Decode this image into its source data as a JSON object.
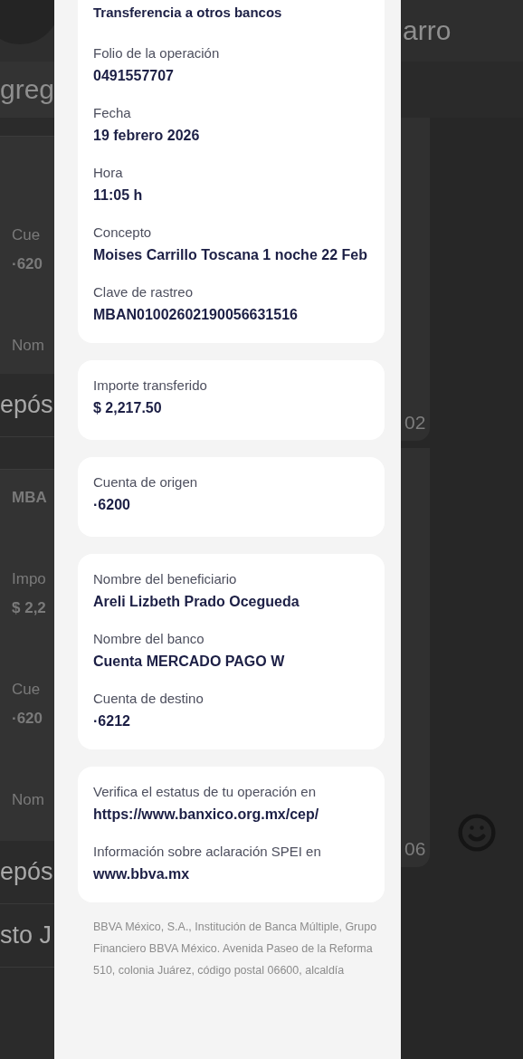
{
  "chat_behind": {
    "header": {
      "title": "arro"
    },
    "compose": {
      "text": "greg"
    },
    "left_edge": [
      {
        "kind": "bubble",
        "lines": [
          {
            "kind": "label",
            "text": "Cue"
          },
          {
            "kind": "value",
            "text": "·620"
          },
          {
            "kind": "label",
            "text": "Nom"
          }
        ]
      },
      {
        "kind": "caption",
        "text": "epós"
      },
      {
        "kind": "bubble",
        "lines": [
          {
            "kind": "value",
            "text": "MBA"
          },
          {
            "kind": "label",
            "text": "Impo"
          },
          {
            "kind": "value",
            "text": "$ 2,2"
          },
          {
            "kind": "label",
            "text": "Cue"
          },
          {
            "kind": "value",
            "text": "·620"
          },
          {
            "kind": "label",
            "text": "Nom"
          }
        ]
      },
      {
        "kind": "caption",
        "text": "epós"
      },
      {
        "kind": "caption",
        "text": "sto J"
      }
    ],
    "right_edge": [
      {
        "time": "02"
      },
      {
        "time": "06"
      }
    ]
  },
  "receipt": {
    "cards": [
      {
        "title": "Transferencia a otros bancos",
        "fields": [
          {
            "label": "Folio de la operación",
            "value": "0491557707"
          },
          {
            "label": "Fecha",
            "value": "19 febrero 2026"
          },
          {
            "label": "Hora",
            "value": "11:05 h"
          },
          {
            "label": "Concepto",
            "value": "Moises Carrillo Toscana 1 noche 22 Feb"
          },
          {
            "label": "Clave de rastreo",
            "value": "MBAN01002602190056631516"
          }
        ]
      },
      {
        "fields": [
          {
            "label": "Importe transferido",
            "value": "$ 2,217.50"
          }
        ]
      },
      {
        "fields": [
          {
            "label": "Cuenta de origen",
            "value": "·6200"
          }
        ]
      },
      {
        "fields": [
          {
            "label": "Nombre del beneficiario",
            "value": "Areli Lizbeth Prado Ocegueda"
          },
          {
            "label": "Nombre del banco",
            "value": "Cuenta MERCADO PAGO W"
          },
          {
            "label": "Cuenta de destino",
            "value": "·6212"
          }
        ]
      },
      {
        "fields": [
          {
            "label": "Verifica el estatus de tu operación en",
            "value": "https://www.banxico.org.mx/cep/"
          },
          {
            "label": "Información sobre aclaración SPEI en",
            "value": "www.bbva.mx"
          }
        ]
      }
    ],
    "footer": "BBVA México, S.A., Institución de Banca Múltiple, Grupo Financiero BBVA México. Avenida Paseo de la Reforma 510, colonia Juárez, código postal 06600, alcaldía"
  }
}
